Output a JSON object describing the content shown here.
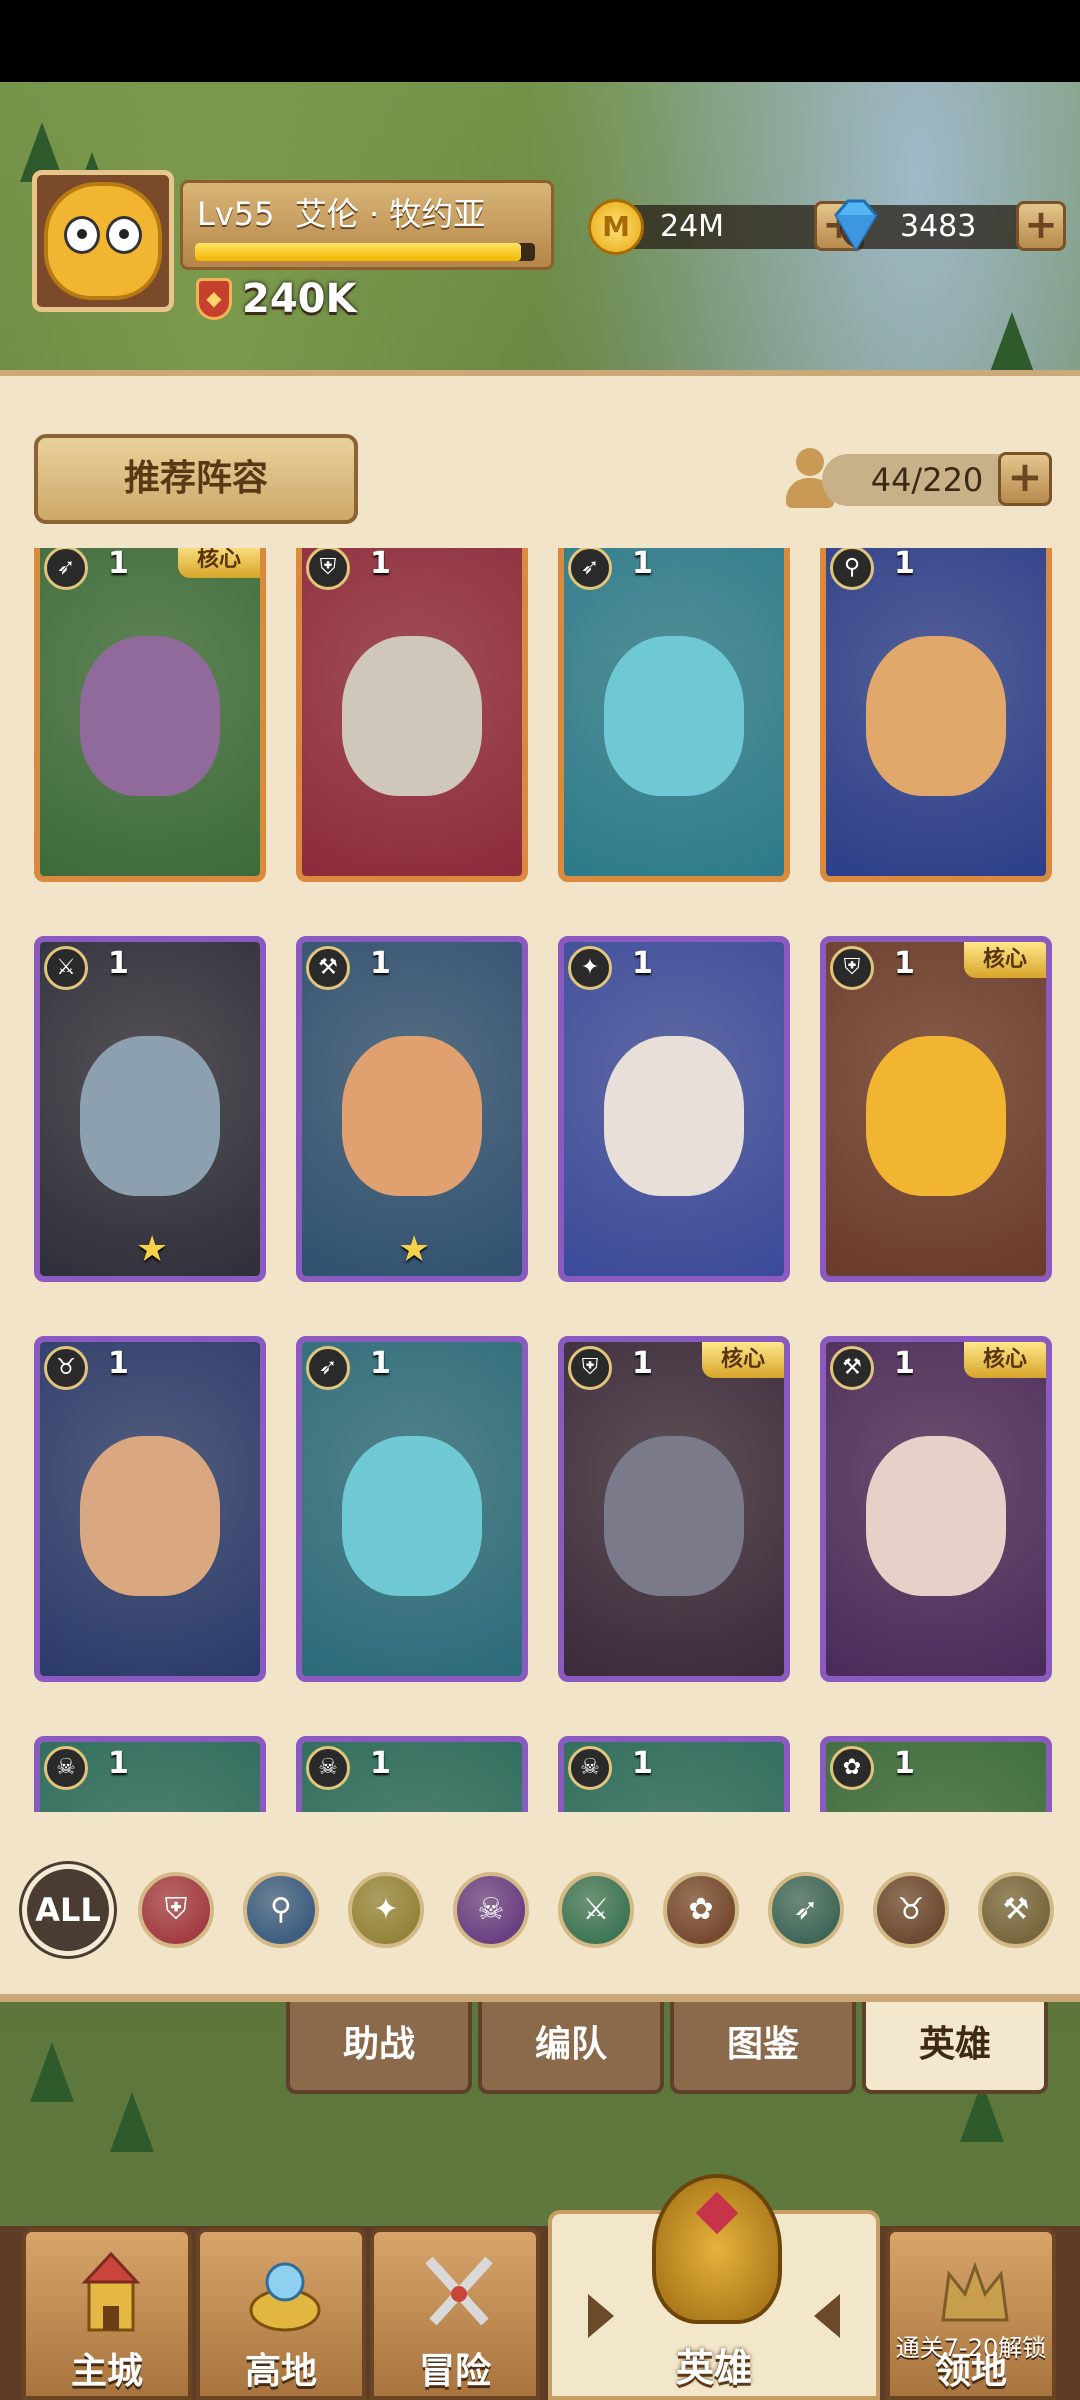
{
  "player": {
    "level": "Lv55",
    "name": "艾伦 · 牧约亚",
    "level_progress": 0.96,
    "power": "240K"
  },
  "resources": {
    "coins": "24M",
    "coin_symbol": "M",
    "gems": "3483"
  },
  "panel": {
    "recommend_label": "推荐阵容",
    "hero_count": "44/220"
  },
  "hero_cards": [
    {
      "level": "1",
      "class_icon": "bow-icon",
      "core": "核心",
      "frame": "orange"
    },
    {
      "level": "1",
      "class_icon": "shield-icon",
      "core": "",
      "frame": "orange"
    },
    {
      "level": "1",
      "class_icon": "bow-icon",
      "core": "",
      "frame": "orange"
    },
    {
      "level": "1",
      "class_icon": "staff-icon",
      "core": "",
      "frame": "orange"
    },
    {
      "level": "1",
      "class_icon": "crossed-blades-icon",
      "core": "",
      "frame": "purple",
      "star": "★"
    },
    {
      "level": "1",
      "class_icon": "axe-icon",
      "core": "",
      "frame": "purple",
      "star": "★"
    },
    {
      "level": "1",
      "class_icon": "holy-icon",
      "core": "",
      "frame": "purple"
    },
    {
      "level": "1",
      "class_icon": "shield-icon",
      "core": "核心",
      "frame": "purple"
    },
    {
      "level": "1",
      "class_icon": "beast-icon",
      "core": "",
      "frame": "purple"
    },
    {
      "level": "1",
      "class_icon": "bow-icon",
      "core": "",
      "frame": "purple"
    },
    {
      "level": "1",
      "class_icon": "shield-icon",
      "core": "核心",
      "frame": "purple"
    },
    {
      "level": "1",
      "class_icon": "axe-icon",
      "core": "核心",
      "frame": "purple"
    },
    {
      "level": "1",
      "class_icon": "skull-icon",
      "core": "",
      "frame": "purple"
    },
    {
      "level": "1",
      "class_icon": "skull-icon",
      "core": "",
      "frame": "purple"
    },
    {
      "level": "1",
      "class_icon": "skull-icon",
      "core": "",
      "frame": "purple"
    },
    {
      "level": "1",
      "class_icon": "paw-icon",
      "core": "",
      "frame": "purple"
    }
  ],
  "filters": {
    "all_label": "ALL",
    "items": [
      {
        "icon": "shield-filter-icon",
        "color": "#9a2b35"
      },
      {
        "icon": "staff-filter-icon",
        "color": "#2a4f7a"
      },
      {
        "icon": "holy-filter-icon",
        "color": "#8a7a2c"
      },
      {
        "icon": "skull-filter-icon",
        "color": "#5b2e7c"
      },
      {
        "icon": "blades-filter-icon",
        "color": "#2b6a4a"
      },
      {
        "icon": "paw-filter-icon",
        "color": "#6a3a20"
      },
      {
        "icon": "bow-filter-icon",
        "color": "#2c5a4e"
      },
      {
        "icon": "beast-filter-icon",
        "color": "#5e3a22"
      },
      {
        "icon": "axe-filter-icon",
        "color": "#6a5a30"
      }
    ]
  },
  "tabs": [
    {
      "label": "助战"
    },
    {
      "label": "编队"
    },
    {
      "label": "图鉴"
    },
    {
      "label": "英雄"
    }
  ],
  "nav": {
    "main_city": "主城",
    "highland": "高地",
    "adventure": "冒险",
    "heroes": "英雄",
    "territory": "领地",
    "territory_locked": "通关7-20解锁"
  }
}
